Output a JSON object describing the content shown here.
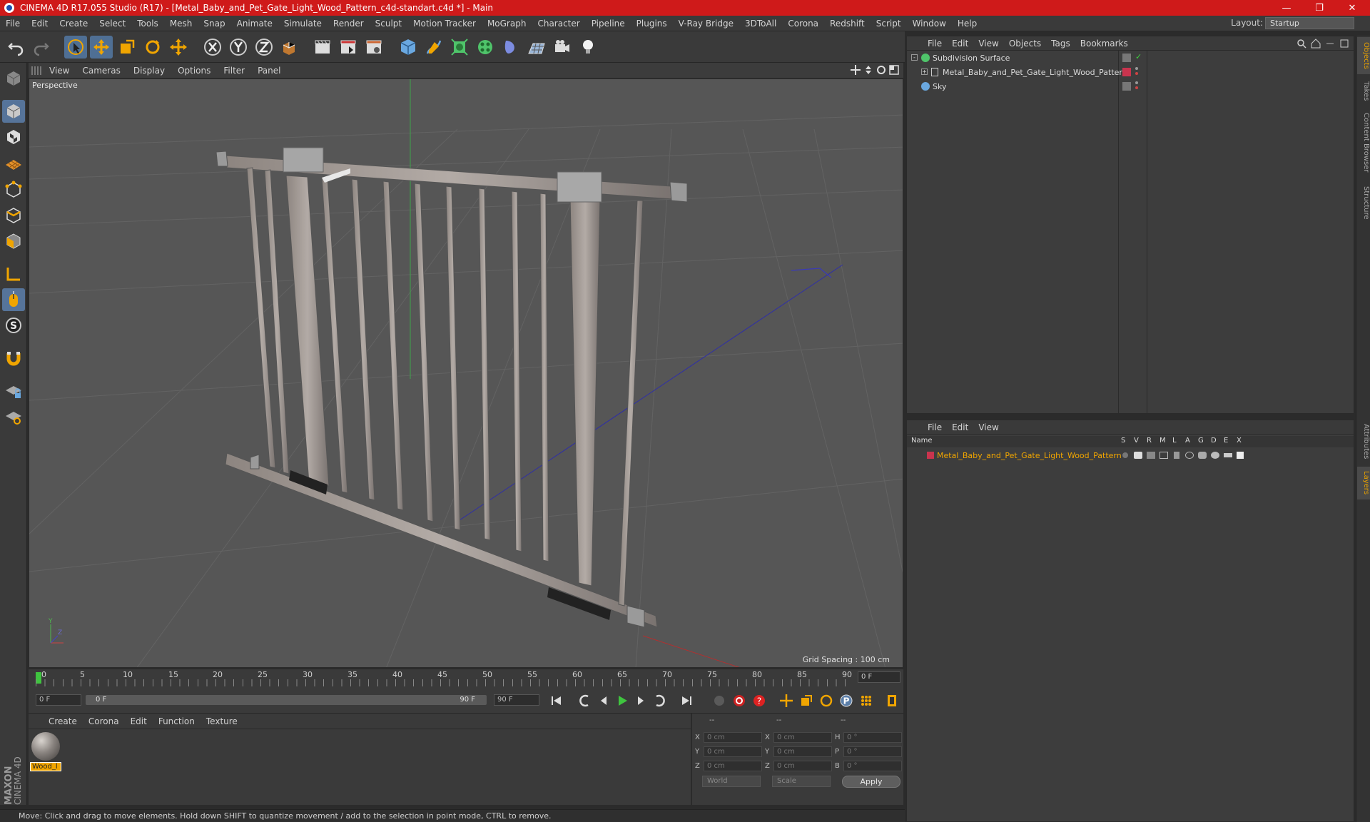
{
  "window": {
    "title": "CINEMA 4D R17.055 Studio (R17) - [Metal_Baby_and_Pet_Gate_Light_Wood_Pattern_c4d-standart.c4d *] - Main",
    "minimize": "—",
    "maximize": "❐",
    "close": "✕"
  },
  "menubar": {
    "items": [
      "File",
      "Edit",
      "Create",
      "Select",
      "Tools",
      "Mesh",
      "Snap",
      "Animate",
      "Simulate",
      "Render",
      "Sculpt",
      "Motion Tracker",
      "MoGraph",
      "Character",
      "Pipeline",
      "Plugins",
      "V-Ray Bridge",
      "3DToAll",
      "Corona",
      "Redshift",
      "Script",
      "Window",
      "Help"
    ],
    "layout_label": "Layout:",
    "layout_value": "Startup"
  },
  "viewport": {
    "menu": [
      "View",
      "Cameras",
      "Display",
      "Options",
      "Filter",
      "Panel"
    ],
    "label": "Perspective",
    "grid_spacing": "Grid Spacing : 100 cm"
  },
  "timeline": {
    "ticks": [
      "0",
      "5",
      "10",
      "15",
      "20",
      "25",
      "30",
      "35",
      "40",
      "45",
      "50",
      "55",
      "60",
      "65",
      "70",
      "75",
      "80",
      "85",
      "90"
    ],
    "current_frame": "0 F"
  },
  "transport": {
    "start": "0 F",
    "range_start": "0 F",
    "range_end": "90 F",
    "end": "90 F"
  },
  "material_panel": {
    "menu": [
      "Create",
      "Corona",
      "Edit",
      "Function",
      "Texture"
    ],
    "material_name": "Wood_l"
  },
  "coords": {
    "header1": "--",
    "header2": "--",
    "header3": "--",
    "rows": [
      {
        "l1": "X",
        "v1": "0 cm",
        "l2": "X",
        "v2": "0 cm",
        "l3": "H",
        "v3": "0 °"
      },
      {
        "l1": "Y",
        "v1": "0 cm",
        "l2": "Y",
        "v2": "0 cm",
        "l3": "P",
        "v3": "0 °"
      },
      {
        "l1": "Z",
        "v1": "0 cm",
        "l2": "Z",
        "v2": "0 cm",
        "l3": "B",
        "v3": "0 °"
      }
    ],
    "mode1": "World",
    "mode2": "Scale",
    "apply": "Apply"
  },
  "status": "Move: Click and drag to move elements. Hold down SHIFT to quantize movement / add to the selection in point mode, CTRL to remove.",
  "objects_panel": {
    "menu": [
      "File",
      "Edit",
      "View",
      "Objects",
      "Tags",
      "Bookmarks"
    ],
    "rows": [
      {
        "name": "Subdivision Surface"
      },
      {
        "name": "Metal_Baby_and_Pet_Gate_Light_Wood_Pattern"
      },
      {
        "name": "Sky"
      }
    ]
  },
  "layers_panel": {
    "menu": [
      "File",
      "Edit",
      "View"
    ],
    "columns": [
      "Name",
      "S",
      "V",
      "R",
      "M",
      "L",
      "A",
      "G",
      "D",
      "E",
      "X"
    ],
    "rows": [
      {
        "name": "Metal_Baby_and_Pet_Gate_Light_Wood_Pattern"
      }
    ]
  },
  "side_tabs": [
    "Objects",
    "Takes",
    "Content Browser",
    "Structure",
    "Attributes",
    "Layers"
  ],
  "brand": {
    "line1": "MAXON",
    "line2": "CINEMA 4D"
  },
  "colors": {
    "title_bar": "#cf1a1a",
    "accent": "#f0a500",
    "active_tool": "#4f6f94"
  }
}
